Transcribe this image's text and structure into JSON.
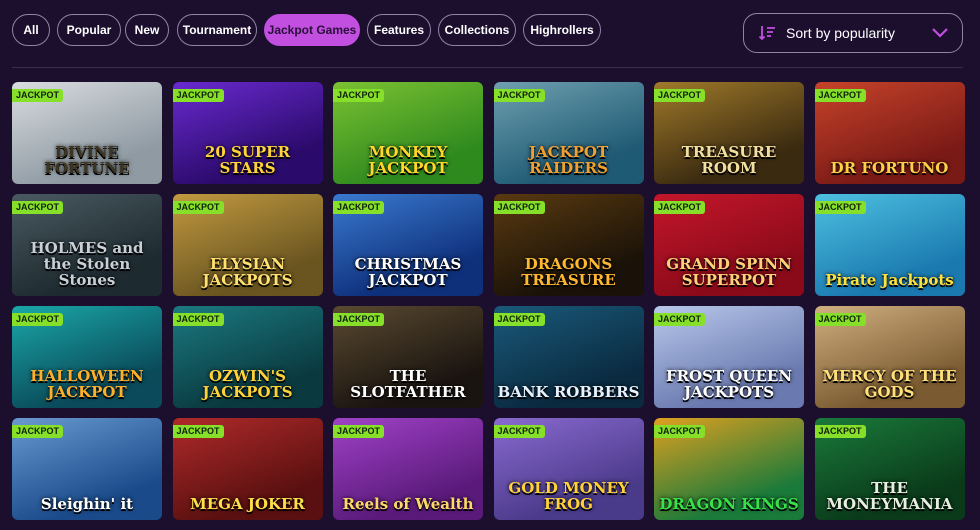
{
  "filters": [
    {
      "label": "All",
      "active": false
    },
    {
      "label": "Popular",
      "active": false
    },
    {
      "label": "New",
      "active": false
    },
    {
      "label": "Tournament",
      "active": false
    },
    {
      "label": "Jackpot Games",
      "active": true
    },
    {
      "label": "Features",
      "active": false
    },
    {
      "label": "Collections",
      "active": false
    },
    {
      "label": "Highrollers",
      "active": false
    }
  ],
  "sort": {
    "label": "Sort by popularity"
  },
  "badge_label": "JACKPOT",
  "games": [
    {
      "title": "DIVINE FORTUNE",
      "bg": "#8f9aa3",
      "bg2": "#d9dde0",
      "text": "#3d3522"
    },
    {
      "title": "20 SUPER STARS",
      "bg": "#2a0a6a",
      "bg2": "#6a2ad0",
      "text": "#ffd43a"
    },
    {
      "title": "MONKEY JACKPOT",
      "bg": "#2f8a1e",
      "bg2": "#7cc232",
      "text": "#ffd62a"
    },
    {
      "title": "JACKPOT RAIDERS",
      "bg": "#1f5a74",
      "bg2": "#6fa0b0",
      "text": "#f0a030"
    },
    {
      "title": "TREASURE ROOM",
      "bg": "#3a2a10",
      "bg2": "#a07a2a",
      "text": "#f3e0a0"
    },
    {
      "title": "DR FORTUNO",
      "bg": "#7a1a16",
      "bg2": "#c7432a",
      "text": "#ffcf4a"
    },
    {
      "title": "HOLMES and the Stolen Stones",
      "bg": "#1d2a30",
      "bg2": "#4a5a60",
      "text": "#c8d0d6"
    },
    {
      "title": "ELYSIAN JACKPOTS",
      "bg": "#6a5520",
      "bg2": "#c29a40",
      "text": "#ffe070"
    },
    {
      "title": "CHRISTMAS JACKPOT",
      "bg": "#0e2f7a",
      "bg2": "#3a7ad0",
      "text": "#ffffff"
    },
    {
      "title": "DRAGONS TREASURE",
      "bg": "#1a1208",
      "bg2": "#5a3a10",
      "text": "#ffb830"
    },
    {
      "title": "GRAND SPINN SUPERPOT",
      "bg": "#8a0a1a",
      "bg2": "#c4172a",
      "text": "#ffd07a"
    },
    {
      "title": "Pirate Jackpots",
      "bg": "#1a7ab0",
      "bg2": "#4ec0e0",
      "text": "#ffe13a"
    },
    {
      "title": "HALLOWEEN JACKPOT",
      "bg": "#0a4a5a",
      "bg2": "#1aa8a8",
      "text": "#ffb02a"
    },
    {
      "title": "OZWIN'S JACKPOTS",
      "bg": "#0a3a40",
      "bg2": "#1a7a80",
      "text": "#ffd23a"
    },
    {
      "title": "THE SLOTFATHER",
      "bg": "#1a1410",
      "bg2": "#5a4a30",
      "text": "#ffffff"
    },
    {
      "title": "BANK ROBBERS",
      "bg": "#0a2a40",
      "bg2": "#1a5a7a",
      "text": "#e8f2ff"
    },
    {
      "title": "FROST QUEEN JACKPOTS",
      "bg": "#6a7ab0",
      "bg2": "#b8c8ea",
      "text": "#ffffff"
    },
    {
      "title": "MERCY OF THE GODS",
      "bg": "#7a5a30",
      "bg2": "#d0b080",
      "text": "#ffe07a"
    },
    {
      "title": "Sleighin' it",
      "bg": "#1a4a8a",
      "bg2": "#6a9ad0",
      "text": "#ffffff"
    },
    {
      "title": "MEGA JOKER",
      "bg": "#5a1010",
      "bg2": "#b02a2a",
      "text": "#ffe04a"
    },
    {
      "title": "Reels of Wealth",
      "bg": "#5a1a7a",
      "bg2": "#a042c8",
      "text": "#ffd86a"
    },
    {
      "title": "GOLD MONEY FROG",
      "bg": "#4a3a8a",
      "bg2": "#8a6ad0",
      "text": "#ffd23a"
    },
    {
      "title": "DRAGON KINGS",
      "bg": "#1a7a3a",
      "bg2": "#e0a020",
      "text": "#3ae04a"
    },
    {
      "title": "THE MONEYMANIA",
      "bg": "#0a3a1a",
      "bg2": "#1a7a3a",
      "text": "#e8f0e0"
    }
  ]
}
